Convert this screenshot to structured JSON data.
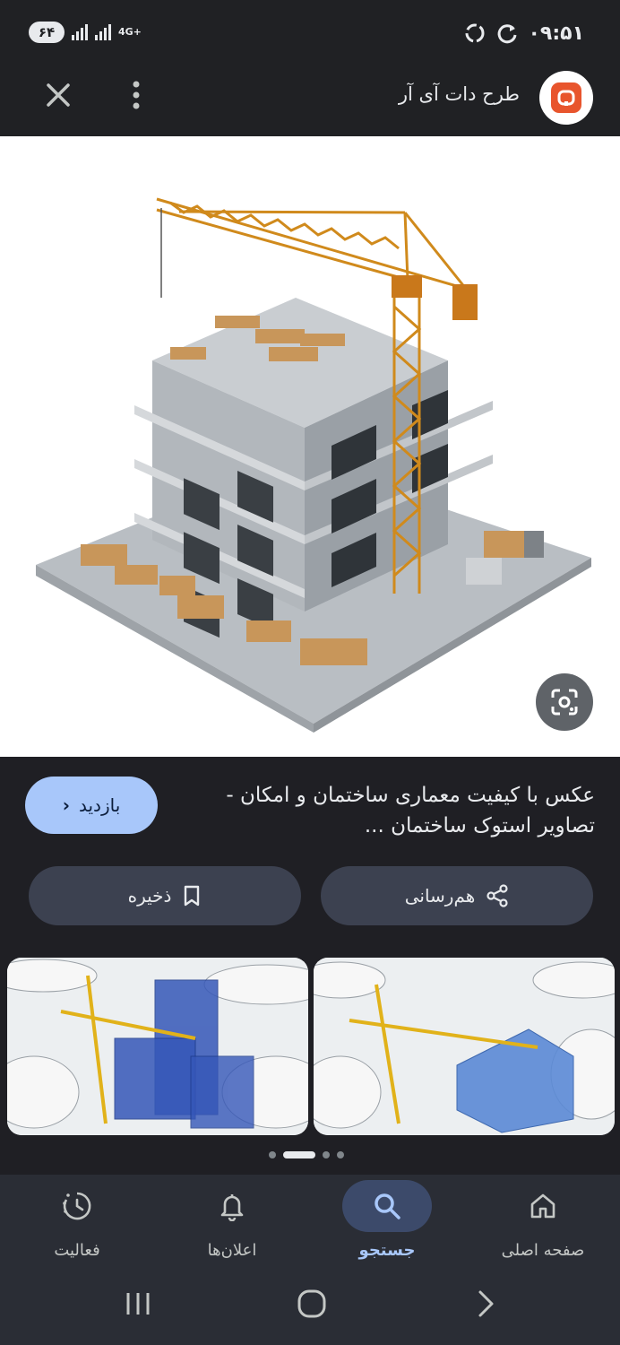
{
  "status_bar": {
    "time": "۰۹:۵۱",
    "battery": "۶۴",
    "network": "4G+"
  },
  "header": {
    "site_name": "طرح دات آی آر",
    "logo_icon": "site-logo-icon",
    "close_icon": "close-icon",
    "menu_icon": "more-vert-icon"
  },
  "main_image": {
    "subject": "isometric building under construction with tower crane",
    "lens_icon": "google-lens-icon"
  },
  "result": {
    "title": "عکس با کیفیت معماری ساختمان و امکان - تصاویر استوک ساختمان ...",
    "visit_label": "بازدید",
    "share_label": "هم‌رسانی",
    "save_label": "ذخیره"
  },
  "related": {
    "items": [
      {
        "subject": "blue building frame with yellow crane on blueprints"
      },
      {
        "subject": "glass building with yellow crane on blueprints"
      }
    ],
    "active_page": 1,
    "page_count": 4
  },
  "bottom_nav": {
    "items": [
      {
        "label": "صفحه اصلی",
        "icon": "home-icon",
        "active": false
      },
      {
        "label": "جستجو",
        "icon": "search-icon",
        "active": true
      },
      {
        "label": "اعلان‌ها",
        "icon": "bell-icon",
        "active": false
      },
      {
        "label": "فعالیت",
        "icon": "activity-clock-icon",
        "active": false
      }
    ]
  },
  "colors": {
    "background": "#1f1f24",
    "accent": "#a8c7fa",
    "pill": "#3c4150",
    "logo": "#e8552d"
  }
}
